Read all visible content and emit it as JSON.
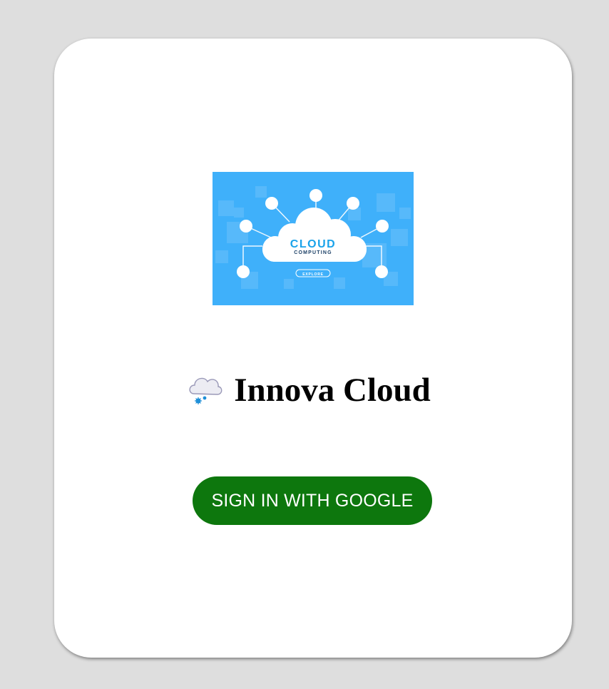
{
  "hero": {
    "title_line1": "CLOUD",
    "title_line2": "COMPUTING",
    "button_label": "EXPLORE"
  },
  "brand": {
    "emoji": "cloud-with-snow-icon",
    "title": "Innova Cloud"
  },
  "auth": {
    "signin_label": "SIGN IN WITH GOOGLE"
  },
  "colors": {
    "page_background": "#dedede",
    "card_background": "#ffffff",
    "hero_background": "#3fb0fa",
    "signin_button": "#0d770d",
    "signin_text": "#ffffff"
  }
}
